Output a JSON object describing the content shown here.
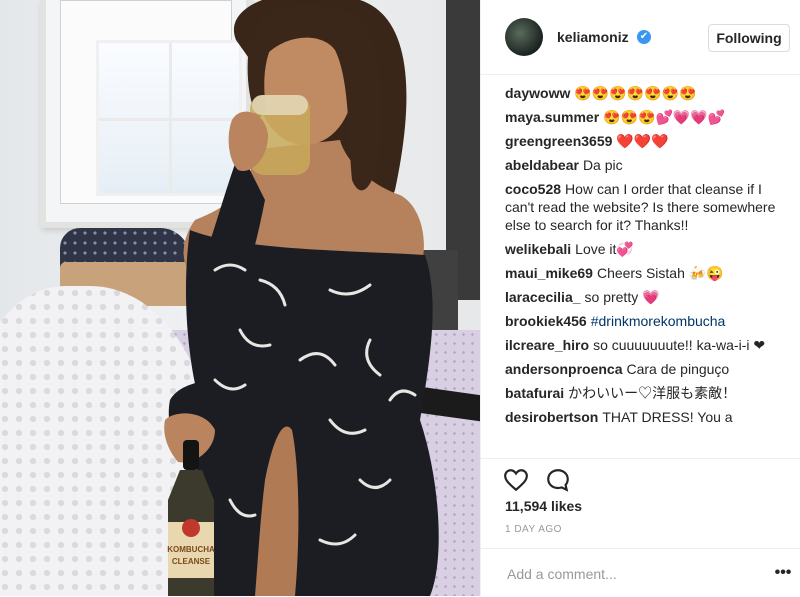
{
  "post": {
    "username": "keliamoniz",
    "follow_label": "Following",
    "likes": "11,594 likes",
    "timestamp": "1 DAY AGO",
    "comment_placeholder": "Add a comment...",
    "more_label": "•••",
    "verified_mark": "✔"
  },
  "photo": {
    "bottle_label_1": "KOMBUCHA",
    "bottle_label_2": "CLEANSE"
  },
  "comments": [
    {
      "user": "daywoww",
      "text": "😍😍😍😍😍😍😍"
    },
    {
      "user": "maya.summer",
      "text": "😍😍😍💕💗💗💕"
    },
    {
      "user": "greengreen3659",
      "text": "❤️❤️❤️"
    },
    {
      "user": "abeldabear",
      "text": "Da pic"
    },
    {
      "user": "coco528",
      "text": "How can I order that cleanse if I can't read the website? Is there somewhere else to search for it? Thanks!!"
    },
    {
      "user": "welikebali",
      "text": "Love it💞"
    },
    {
      "user": "maui_mike69",
      "text": "Cheers Sistah 🍻😜"
    },
    {
      "user": "laracecilia_",
      "text": "so pretty 💗"
    },
    {
      "user": "brookiek456",
      "text": "#drinkmorekombucha"
    },
    {
      "user": "ilcreare_hiro",
      "text": "so cuuuuuuute!! ka-wa-i-i ❤"
    },
    {
      "user": "andersonproenca",
      "text": "Cara de pinguço"
    },
    {
      "user": "batafurai",
      "text": "かわいいー♡洋服も素敵！"
    },
    {
      "user": "desirobertson",
      "text": "THAT DRESS! You a"
    }
  ],
  "colors": {
    "verified": "#3897f0",
    "hashtag": "#003569",
    "muted": "#999999"
  },
  "icons": {
    "like": "heart-icon",
    "comment": "comment-icon",
    "verified": "verified-badge-icon",
    "more": "more-options-icon"
  }
}
